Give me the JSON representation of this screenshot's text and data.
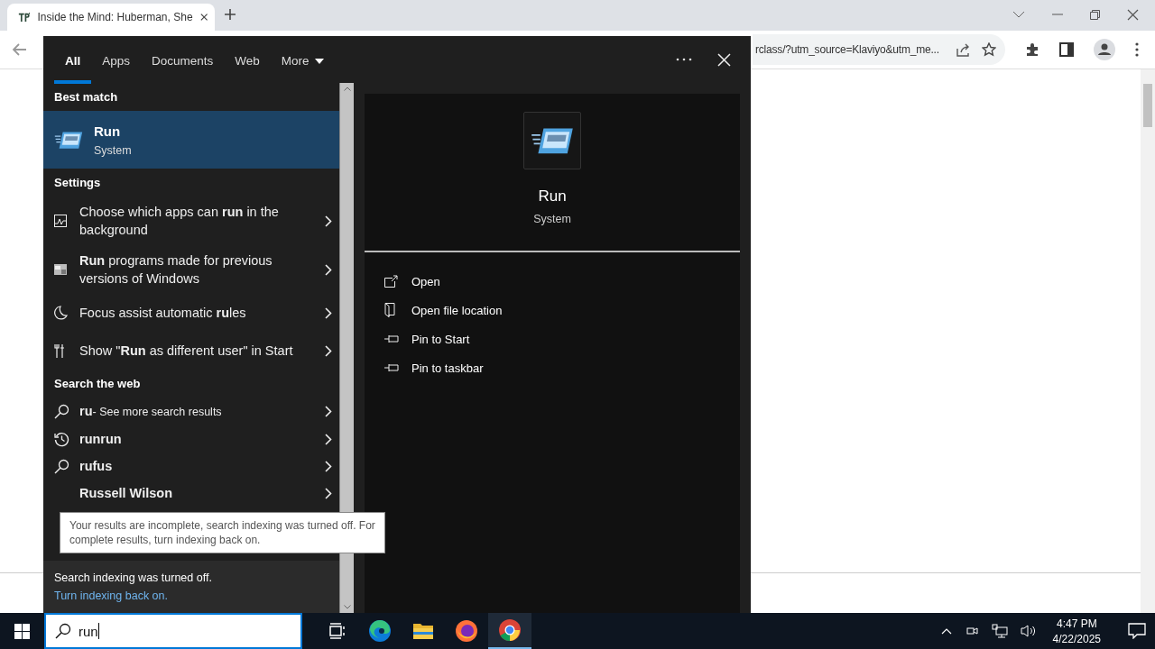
{
  "browser": {
    "tab": {
      "title": "Inside the Mind: Huberman, She",
      "selected": true
    },
    "address": "rclass/?utm_source=Klaviyo&utm_me..."
  },
  "search_flyout": {
    "tabs": [
      {
        "label": "All",
        "selected": true
      },
      {
        "label": "Apps",
        "selected": false
      },
      {
        "label": "Documents",
        "selected": false
      },
      {
        "label": "Web",
        "selected": false
      },
      {
        "label": "More",
        "selected": false,
        "dropdown": true
      }
    ],
    "best_match_heading": "Best match",
    "best_match": {
      "title": "Run",
      "subtitle": "System",
      "selected": true
    },
    "settings_heading": "Settings",
    "settings": [
      {
        "kind": "chart",
        "text": "Choose which apps can **run** in the background"
      },
      {
        "kind": "window",
        "text": "**Run** programs made for previous versions of Windows"
      },
      {
        "kind": "moon",
        "text": "Focus assist automatic **ru**les"
      },
      {
        "kind": "tools",
        "text": "Show \"**Run** as different user\" in Start"
      }
    ],
    "web_heading": "Search the web",
    "web": [
      {
        "kind": "search",
        "text": "ru",
        "note": "- See more search results"
      },
      {
        "kind": "history",
        "text": "runrun"
      },
      {
        "kind": "search",
        "text": "rufus"
      },
      {
        "kind": "none",
        "text": "Russell Wilson"
      }
    ],
    "tooltip": "Your results are incomplete, search indexing was turned off. For complete results, turn indexing back on.",
    "indexing_notice": "Search indexing was turned off.",
    "indexing_link": "Turn indexing back on.",
    "preview": {
      "title": "Run",
      "subtitle": "System",
      "actions": [
        {
          "kind": "open",
          "label": "Open"
        },
        {
          "kind": "folder",
          "label": "Open file location"
        },
        {
          "kind": "pin",
          "label": "Pin to Start"
        },
        {
          "kind": "pin",
          "label": "Pin to taskbar"
        }
      ]
    }
  },
  "taskbar": {
    "search_value": "run",
    "apps": [
      {
        "kind": "taskview",
        "selected": false
      },
      {
        "kind": "edge",
        "selected": false
      },
      {
        "kind": "explorer",
        "selected": false
      },
      {
        "kind": "firefox",
        "selected": false
      },
      {
        "kind": "chrome",
        "selected": true
      }
    ],
    "time": "4:47 PM",
    "date": "4/22/2025"
  }
}
